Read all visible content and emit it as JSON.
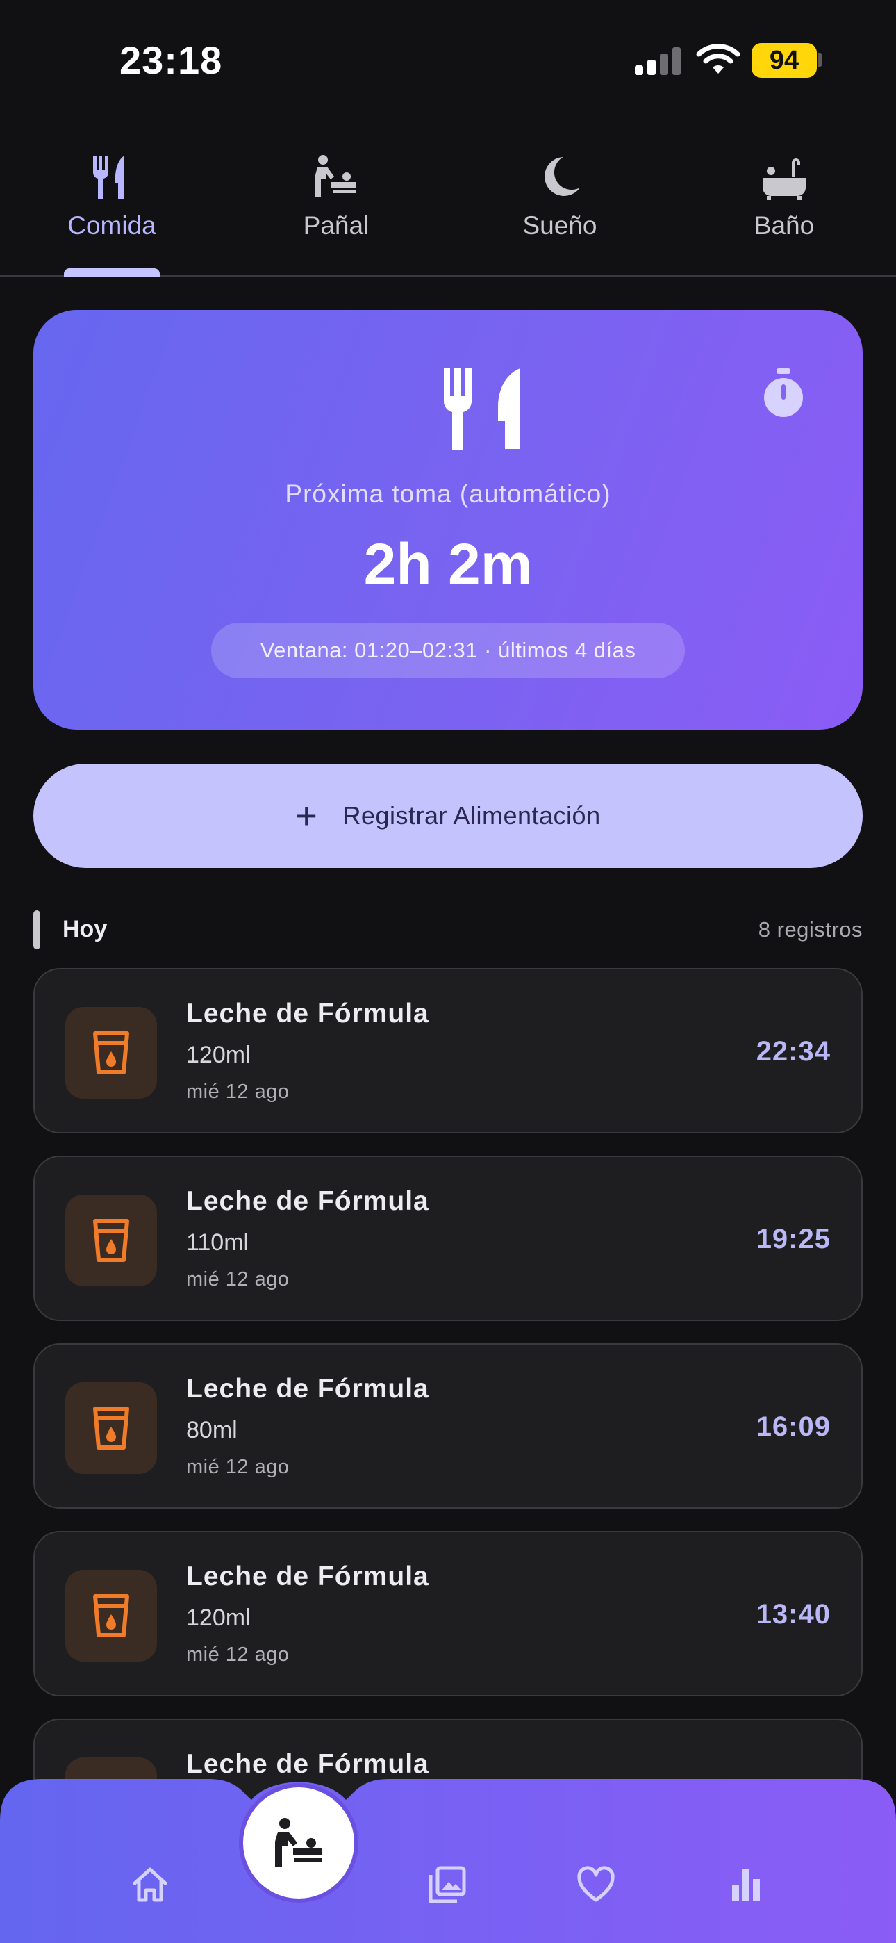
{
  "status": {
    "time": "23:18",
    "battery": "94"
  },
  "tabs": [
    {
      "label": "Comida",
      "icon": "fork-knife-icon",
      "active": true
    },
    {
      "label": "Pañal",
      "icon": "baby-changing-icon",
      "active": false
    },
    {
      "label": "Sueño",
      "icon": "moon-icon",
      "active": false
    },
    {
      "label": "Baño",
      "icon": "bathtub-icon",
      "active": false
    }
  ],
  "hero": {
    "subtitle": "Próxima toma (automático)",
    "value": "2h 2m",
    "window": "Ventana: 01:20–02:31 · últimos 4 días",
    "icon": "fork-knife-icon",
    "action_icon": "stopwatch-icon"
  },
  "register_button": {
    "plus": "+",
    "label": "Registrar Alimentación"
  },
  "section": {
    "title": "Hoy",
    "count": "8 registros"
  },
  "entries": [
    {
      "title": "Leche de Fórmula",
      "amount": "120ml",
      "date": "mié 12 ago",
      "time": "22:34"
    },
    {
      "title": "Leche de Fórmula",
      "amount": "110ml",
      "date": "mié 12 ago",
      "time": "19:25"
    },
    {
      "title": "Leche de Fórmula",
      "amount": "80ml",
      "date": "mié 12 ago",
      "time": "16:09"
    },
    {
      "title": "Leche de Fórmula",
      "amount": "120ml",
      "date": "mié 12 ago",
      "time": "13:40"
    },
    {
      "title": "Leche de Fórmula",
      "amount": "",
      "date": "",
      "time": ""
    }
  ],
  "bottom_nav": [
    "home-icon",
    "baby-changing-icon",
    "gallery-icon",
    "heart-icon",
    "bar-chart-icon"
  ],
  "colors": {
    "accent": "#8B5CF6",
    "accent_start": "#6667F0",
    "entry_icon": "#F07C2A",
    "time_text": "#B9B7F5",
    "register_bg": "#C4C3FE"
  }
}
